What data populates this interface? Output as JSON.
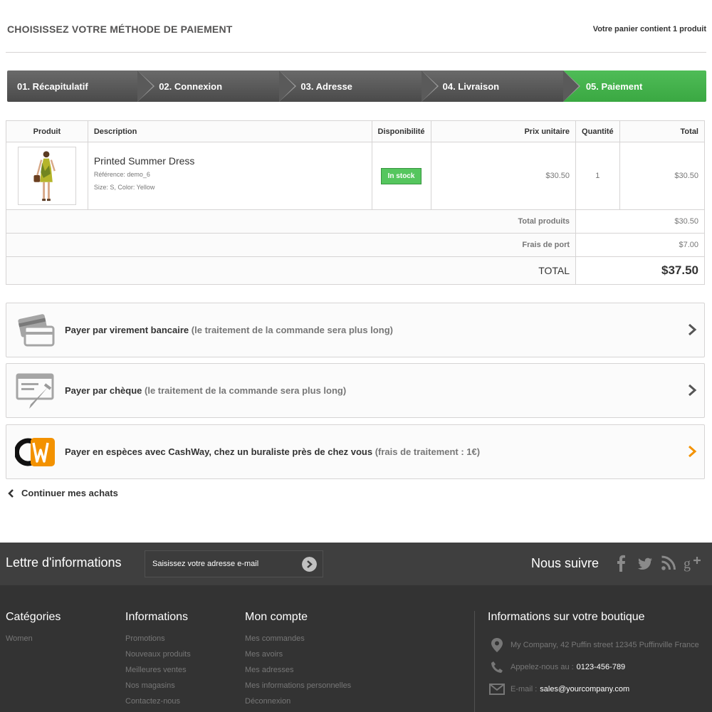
{
  "header": {
    "title": "CHOISISSEZ VOTRE MÉTHODE DE PAIEMENT",
    "cart_summary": "Votre panier contient 1 produit"
  },
  "steps": [
    {
      "label": "01. Récapitulatif"
    },
    {
      "label": "02. Connexion"
    },
    {
      "label": "03. Adresse"
    },
    {
      "label": "04. Livraison"
    },
    {
      "label": "05. Paiement"
    }
  ],
  "table": {
    "headers": [
      "Produit",
      "Description",
      "Disponibilité",
      "Prix unitaire",
      "Quantité",
      "Total"
    ],
    "product": {
      "name": "Printed Summer Dress",
      "reference": "Référence: demo_6",
      "attributes": "Size: S, Color: Yellow",
      "availability": "In stock",
      "unit_price": "$30.50",
      "quantity": "1",
      "total": "$30.50"
    },
    "totals": {
      "products_label": "Total produits",
      "products_value": "$30.50",
      "shipping_label": "Frais de port",
      "shipping_value": "$7.00",
      "grand_label": "TOTAL",
      "grand_value": "$37.50"
    }
  },
  "payments": [
    {
      "label": "Payer par virement bancaire",
      "note": "(le traitement de la commande sera plus long)",
      "icon": "bank-card-icon"
    },
    {
      "label": "Payer par chèque",
      "note": "(le traitement de la commande sera plus long)",
      "icon": "cheque-icon"
    },
    {
      "label": "Payer en espèces avec CashWay, chez un buraliste près de chez vous",
      "note": "(frais de traitement : 1€)",
      "icon": "cashway-logo"
    }
  ],
  "continue_label": "Continuer mes achats",
  "footer": {
    "newsletter_title": "Lettre d'informations",
    "newsletter_placeholder": "Saisissez votre adresse e-mail",
    "follow_title": "Nous suivre",
    "categories": {
      "title": "Catégories",
      "items": [
        "Women"
      ]
    },
    "informations": {
      "title": "Informations",
      "items": [
        "Promotions",
        "Nouveaux produits",
        "Meilleures ventes",
        "Nos magasins",
        "Contactez-nous"
      ]
    },
    "account": {
      "title": "Mon compte",
      "items": [
        "Mes commandes",
        "Mes avoirs",
        "Mes adresses",
        "Mes informations personnelles",
        "Déconnexion"
      ]
    },
    "shop": {
      "title": "Informations sur votre boutique",
      "address": "My Company, 42 Puffin street 12345 Puffinville France",
      "phone_label": "Appelez-nous au :",
      "phone": "0123-456-789",
      "email_label": "E-mail :",
      "email": "sales@yourcompany.com"
    }
  },
  "colors": {
    "accent_green": "#46b54f",
    "cashway_orange": "#f39200"
  }
}
